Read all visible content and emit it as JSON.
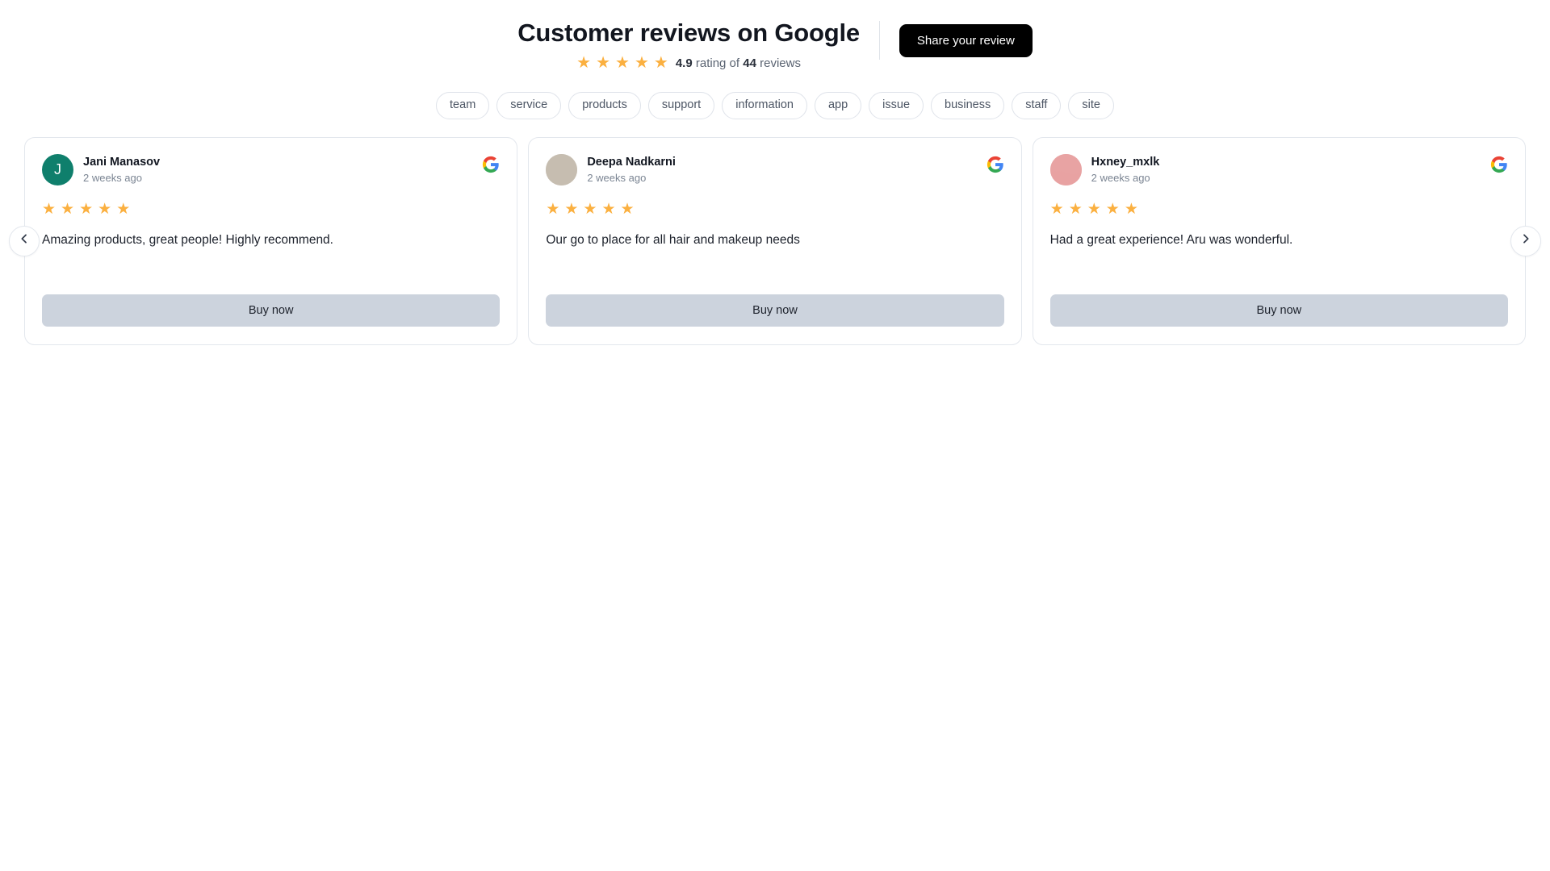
{
  "header": {
    "title": "Customer reviews on Google",
    "rating_value": "4.9",
    "rating_mid": " rating of ",
    "rating_count": "44",
    "rating_suffix": " reviews",
    "star_glyph": "★",
    "header_star_count": 5,
    "share_label": "Share your review",
    "divider": "vertical-divider"
  },
  "tags": [
    {
      "label": "team"
    },
    {
      "label": "service"
    },
    {
      "label": "products"
    },
    {
      "label": "support"
    },
    {
      "label": "information"
    },
    {
      "label": "app"
    },
    {
      "label": "issue"
    },
    {
      "label": "business"
    },
    {
      "label": "staff"
    },
    {
      "label": "site"
    }
  ],
  "carousel": {
    "prev_icon": "chevron-left-icon",
    "next_icon": "chevron-right-icon",
    "buy_label": "Buy now"
  },
  "reviews": [
    {
      "author": "Jani Manasov",
      "time": "2 weeks ago",
      "stars": 5,
      "text": "Amazing products, great people! Highly recommend.",
      "avatar_type": "initial",
      "avatar_initial": "J",
      "avatar_color": "#0f7f6c",
      "source_icon": "google-g-icon",
      "buy_label": "Buy now"
    },
    {
      "author": "Deepa Nadkarni",
      "time": "2 weeks ago",
      "stars": 5,
      "text": "Our go to place for all hair and makeup needs",
      "avatar_type": "photo",
      "avatar_initial": "",
      "avatar_color": "#c6bdb0",
      "source_icon": "google-g-icon",
      "buy_label": "Buy now"
    },
    {
      "author": "Hxney_mxlk",
      "time": "2 weeks ago",
      "stars": 5,
      "text": "Had a great experience! Aru was wonderful.",
      "avatar_type": "photo",
      "avatar_initial": "",
      "avatar_color": "#e8a3a3",
      "source_icon": "google-g-icon",
      "buy_label": "Buy now"
    }
  ],
  "colors": {
    "star": "#fbb040",
    "share_button_bg": "#000000",
    "buy_button_bg": "#ccd3dd",
    "card_border": "#e3e7ed"
  }
}
